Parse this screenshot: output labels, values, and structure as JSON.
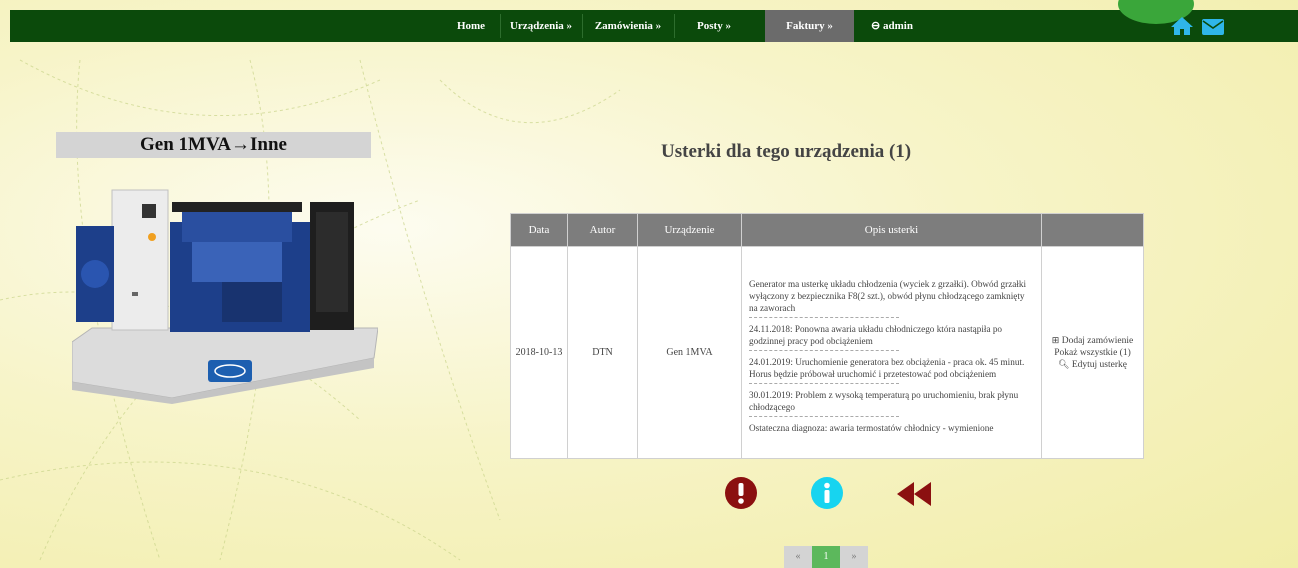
{
  "nav": {
    "items": [
      {
        "label": "Home"
      },
      {
        "label": "Urządzenia »"
      },
      {
        "label": "Zamówienia »"
      },
      {
        "label": "Posty »"
      },
      {
        "label": "Faktury »"
      },
      {
        "label": "⊖ admin"
      }
    ],
    "home_icon": "home-icon",
    "mail_icon": "envelope-icon"
  },
  "device": {
    "title": "Gen 1MVA→Inne"
  },
  "faults": {
    "heading": "Usterki dla tego urządzenia (1)",
    "columns": [
      "Data",
      "Autor",
      "Urządzenie",
      "Opis usterki",
      ""
    ],
    "row": {
      "date": "2018-10-13",
      "author": "DTN",
      "device": "Gen 1MVA",
      "description": [
        "Generator ma usterkę układu chłodzenia (wyciek z grzałki). Obwód grzałki wyłączony z bezpiecznika F8(2 szt.), obwód płynu chłodzącego zamknięty na zaworach",
        "24.11.2018: Ponowna awaria układu chłodniczego która nastąpiła po godzinnej pracy pod obciążeniem",
        "24.01.2019: Uruchomienie generatora bez obciążenia - praca ok. 45 minut. Horus będzie próbował uruchomić i przetestować pod obciążeniem",
        "30.01.2019: Problem z wysoką temperaturą po uruchomieniu, brak płynu chłodzącego",
        "Ostateczna diagnoza: awaria termostatów chłodnicy - wymienione"
      ],
      "actions": {
        "add_order": "Dodaj zamówienie",
        "show_all": "Pokaż wszystkie (1)",
        "edit": "Edytuj usterkę"
      }
    }
  },
  "icons": {
    "alert": "exclamation-circle-icon",
    "info": "info-circle-icon",
    "back": "fast-backward-icon",
    "alert_color": "#8b1010",
    "info_color": "#17d4f0",
    "back_color": "#8b1010"
  },
  "pagination": {
    "prev": "«",
    "current": "1",
    "next": "»"
  },
  "colors": {
    "nav_bg": "#0b4a0b",
    "active_tab": "#6b6b6b",
    "accent_green": "#5cb85c",
    "header_gray": "#7d7d7d"
  }
}
